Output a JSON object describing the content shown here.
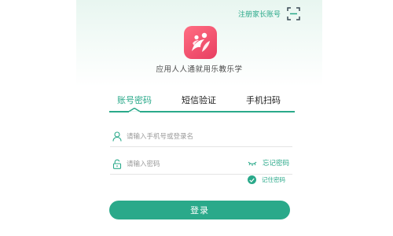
{
  "header": {
    "register_link": "注册家长账号",
    "scan_icon": "scan-icon"
  },
  "app": {
    "logo_icon": "people-logo-icon",
    "subtitle": "应用人人通就用乐教乐学",
    "brand_color": "#2aa98a",
    "logo_color": "#f04d6a"
  },
  "tabs": [
    {
      "label": "账号密码",
      "active": true
    },
    {
      "label": "短信验证",
      "active": false
    },
    {
      "label": "手机扫码",
      "active": false
    }
  ],
  "form": {
    "account": {
      "placeholder": "请输入手机号或登录名",
      "value": "",
      "icon": "user-icon"
    },
    "password": {
      "placeholder": "请输入密码",
      "value": "",
      "icon": "lock-icon"
    },
    "show_password_icon": "eye-closed-icon",
    "forgot_label": "忘记密码",
    "remember_label": "记住密码",
    "remember_checked": true,
    "login_label": "登录"
  }
}
